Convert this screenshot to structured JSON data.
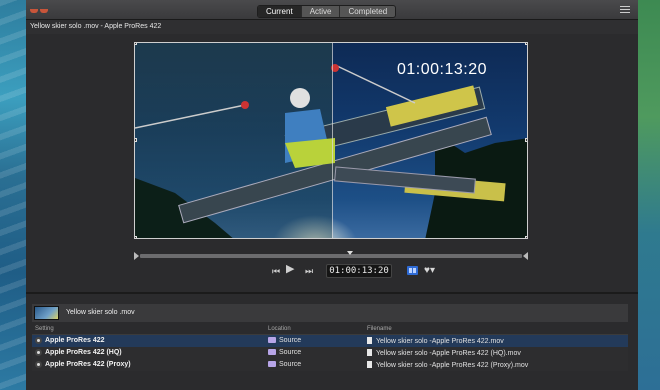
{
  "toolbar": {
    "segments": [
      "Current",
      "Active",
      "Completed"
    ],
    "active_segment": "Current"
  },
  "document": {
    "title": "Yellow skier solo .mov - Apple ProRes 422"
  },
  "viewer": {
    "overlay_timecode": "01:00:13:20"
  },
  "transport": {
    "timecode": "01:00:13:20",
    "buttons": [
      "go-to-start",
      "play",
      "go-to-end",
      "compare-split",
      "favorite"
    ]
  },
  "batch": {
    "source_name": "Yellow skier solo .mov",
    "columns": [
      "Setting",
      "Location",
      "Filename"
    ],
    "rows": [
      {
        "setting": "Apple ProRes 422",
        "location": "Source",
        "filename": "Yellow skier solo -Apple ProRes 422.mov",
        "selected": true
      },
      {
        "setting": "Apple ProRes 422 (HQ)",
        "location": "Source",
        "filename": "Yellow skier solo -Apple ProRes 422 (HQ).mov",
        "selected": false
      },
      {
        "setting": "Apple ProRes 422 (Proxy)",
        "location": "Source",
        "filename": "Yellow skier solo -Apple ProRes 422 (Proxy).mov",
        "selected": false
      }
    ]
  },
  "colors": {
    "accent": "#2e6bd6",
    "selection": "#233a5a",
    "background": "#2b2b2d"
  }
}
